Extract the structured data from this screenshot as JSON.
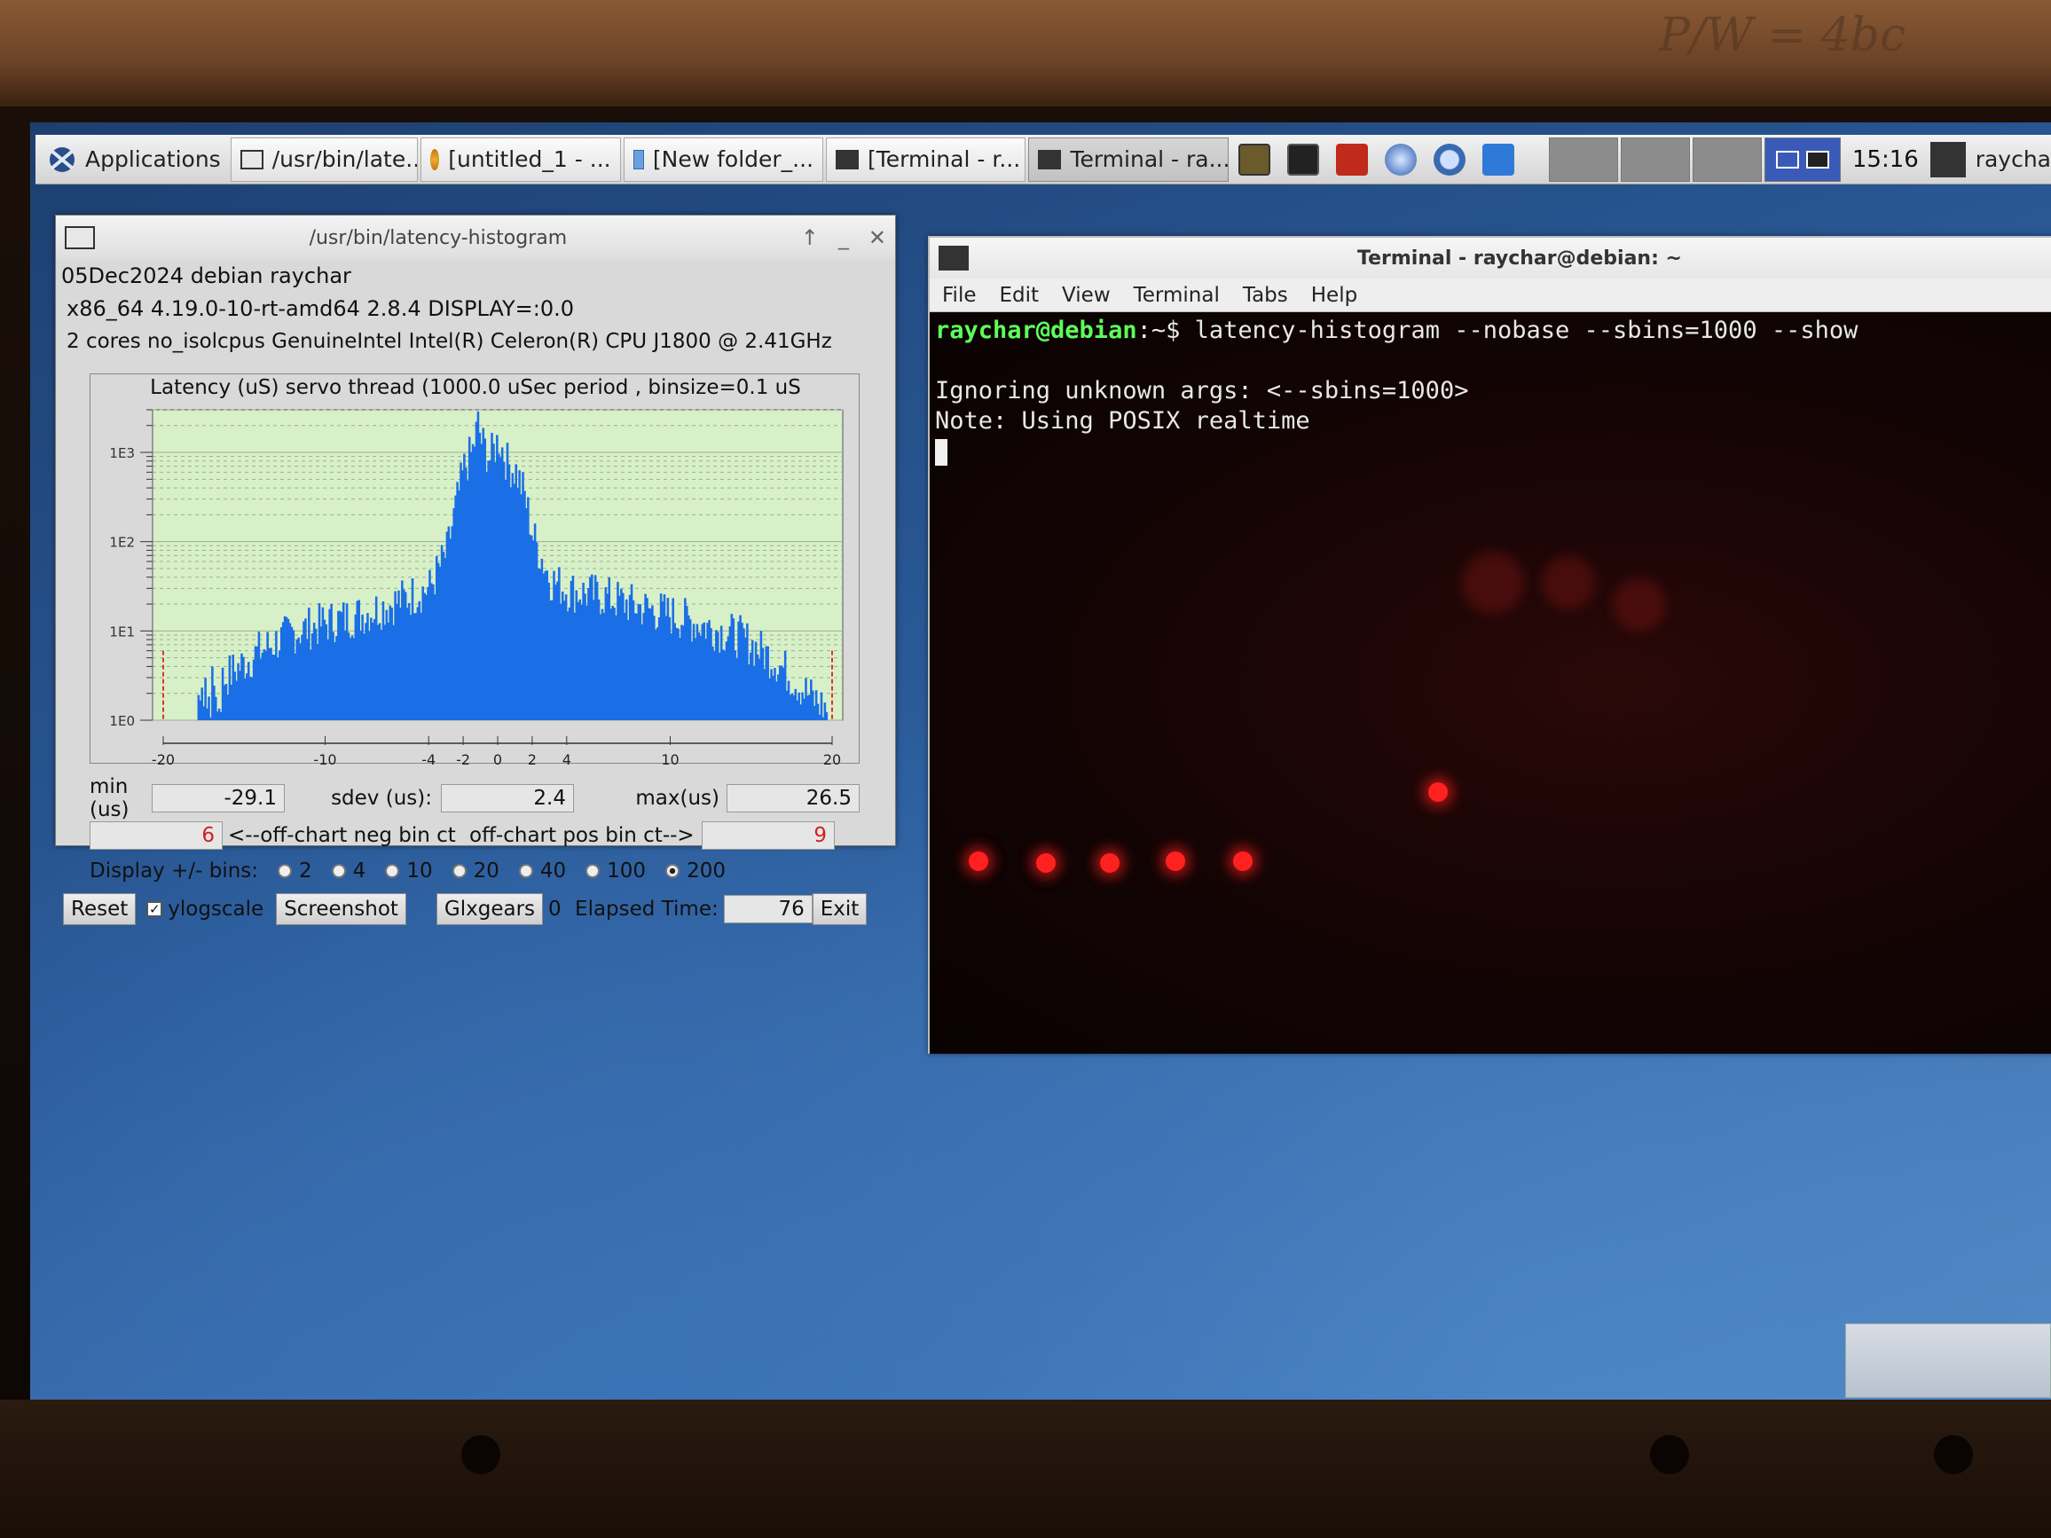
{
  "photo": {
    "scribble": "P/W = 4bc"
  },
  "taskbar": {
    "apps_label": "Applications",
    "tasks": [
      {
        "label": "/usr/bin/late...",
        "icon": "window-icon"
      },
      {
        "label": "[untitled_1 - ...",
        "icon": "paint-icon"
      },
      {
        "label": "[New folder_...",
        "icon": "folder-icon"
      },
      {
        "label": "[Terminal - r...",
        "icon": "terminal-icon"
      },
      {
        "label": "Terminal - ra...",
        "icon": "terminal-icon"
      }
    ],
    "clock": "15:16",
    "user": "raycha"
  },
  "hist_window": {
    "title": "/usr/bin/latency-histogram",
    "info_line1": "05Dec2024 debian raychar",
    "info_line2": "x86_64  4.19.0-10-rt-amd64  2.8.4  DISPLAY=:0.0",
    "info_line3": "2 cores  no_isolcpus  GenuineIntel  Intel(R) Celeron(R) CPU J1800 @ 2.41GHz",
    "min_label": "min (us)",
    "min_value": "-29.1",
    "sdev_label": "sdev (us):",
    "sdev_value": "2.4",
    "max_label": "max(us)",
    "max_value": "26.5",
    "neg_count": "6",
    "neg_label": "<--off-chart neg bin ct",
    "pos_label": "off-chart pos bin ct-->",
    "pos_count": "9",
    "display_label": "Display +/- bins:",
    "bin_options": [
      "2",
      "4",
      "10",
      "20",
      "40",
      "100",
      "200"
    ],
    "bin_selected": "200",
    "reset_label": "Reset",
    "ylog_label": "ylogscale",
    "screenshot_label": "Screenshot",
    "glxgears_label": "Glxgears",
    "glxgears_count": "0",
    "elapsed_label": "Elapsed Time:",
    "elapsed_value": "76",
    "exit_label": "Exit"
  },
  "chart_data": {
    "type": "bar",
    "title": "Latency (uS) servo thread (1000.0 uSec period , binsize=0.1 uS",
    "x_ticks": [
      "-20",
      "-10",
      "-4",
      "-2",
      "0",
      "2",
      "4",
      "10",
      "20"
    ],
    "y_ticks": [
      "1E0",
      "1E1",
      "1E2",
      "1E3"
    ],
    "xlim": [
      -20,
      20
    ],
    "y_scale": "log",
    "ylim": [
      1,
      3000
    ],
    "grid": true,
    "bar_color": "#1a6ee6",
    "background_color": "#d8f0c8",
    "envelope": [
      [
        -20.0,
        1
      ],
      [
        -19.0,
        1
      ],
      [
        -17.5,
        2
      ],
      [
        -16.0,
        3
      ],
      [
        -14.0,
        6
      ],
      [
        -12.0,
        10
      ],
      [
        -10.0,
        13
      ],
      [
        -8.0,
        16
      ],
      [
        -6.0,
        22
      ],
      [
        -4.0,
        32
      ],
      [
        -3.0,
        80
      ],
      [
        -2.5,
        250
      ],
      [
        -2.0,
        700
      ],
      [
        -1.5,
        1100
      ],
      [
        -1.2,
        2200
      ],
      [
        -1.0,
        1400
      ],
      [
        -0.5,
        900
      ],
      [
        0.0,
        1500
      ],
      [
        0.5,
        800
      ],
      [
        1.0,
        650
      ],
      [
        1.5,
        350
      ],
      [
        2.0,
        120
      ],
      [
        3.0,
        40
      ],
      [
        4.0,
        30
      ],
      [
        6.0,
        26
      ],
      [
        8.0,
        20
      ],
      [
        10.0,
        16
      ],
      [
        12.0,
        12
      ],
      [
        14.0,
        9
      ],
      [
        16.0,
        5
      ],
      [
        18.0,
        2
      ],
      [
        20.0,
        1
      ]
    ],
    "offchart_markers": [
      -20,
      20
    ]
  },
  "terminal": {
    "title": "Terminal - raychar@debian: ~",
    "menu": [
      "File",
      "Edit",
      "View",
      "Terminal",
      "Tabs",
      "Help"
    ],
    "prompt": "raychar@debian",
    "path": ":~$ ",
    "command": "latency-histogram --nobase --sbins=1000 --show",
    "line1": "Ignoring unknown args: <--sbins=1000>",
    "line2": "Note: Using POSIX realtime"
  }
}
